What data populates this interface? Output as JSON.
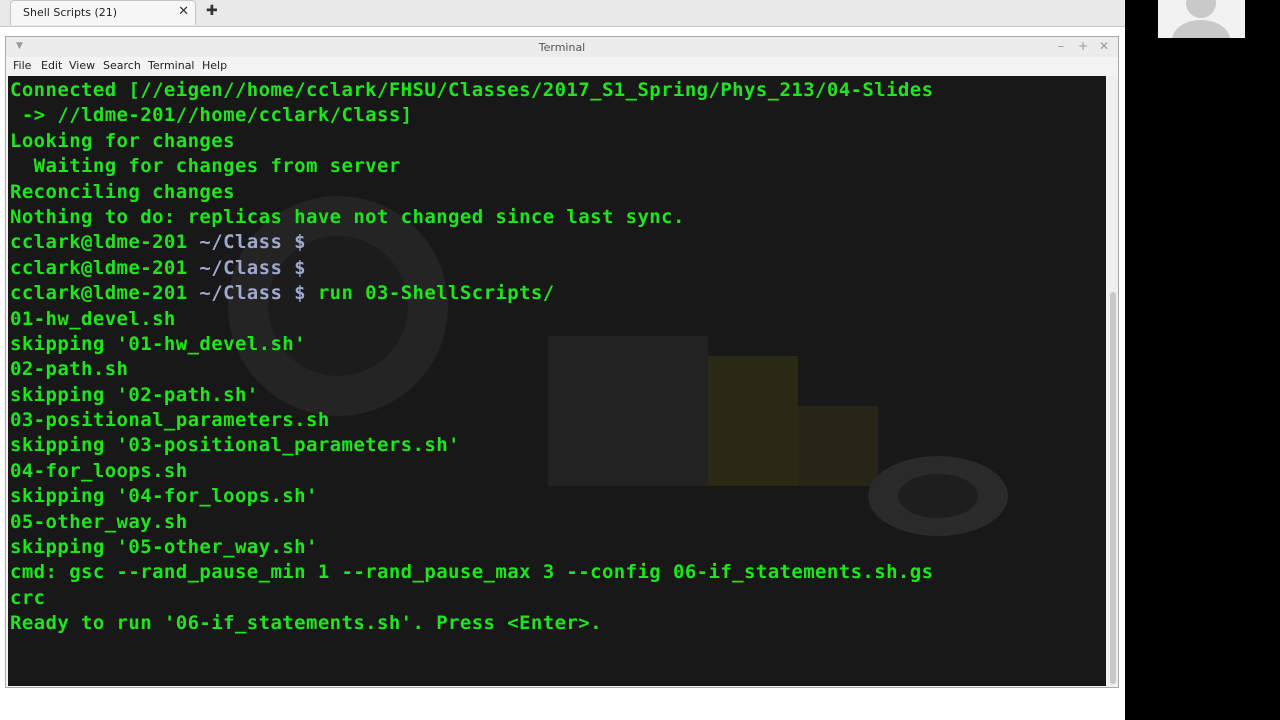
{
  "browser": {
    "tab_label": "Shell Scripts (21)",
    "close_glyph": "✕",
    "newtab_glyph": "✚"
  },
  "terminal": {
    "title": "Terminal",
    "menu": [
      "File",
      "Edit",
      "View",
      "Search",
      "Terminal",
      "Help"
    ],
    "window_buttons": [
      "–",
      "+",
      "✕"
    ],
    "colors": {
      "text": "#1ee51e",
      "path": "#9fa9cf",
      "background": "#181818"
    },
    "lines": [
      {
        "text": "Connected [//eigen//home/cclark/FHSU/Classes/2017_S1_Spring/Phys_213/04-Slides"
      },
      {
        "text": " -> //ldme-201//home/cclark/Class]"
      },
      {
        "text": "Looking for changes"
      },
      {
        "text": "  Waiting for changes from server"
      },
      {
        "text": "Reconciling changes"
      },
      {
        "text": "Nothing to do: replicas have not changed since last sync."
      },
      {
        "user": "cclark@ldme-201",
        "path": " ~/Class $",
        "cmd": ""
      },
      {
        "user": "cclark@ldme-201",
        "path": " ~/Class $",
        "cmd": ""
      },
      {
        "user": "cclark@ldme-201",
        "path": " ~/Class $",
        "cmd": " run 03-ShellScripts/"
      },
      {
        "text": "01-hw_devel.sh"
      },
      {
        "text": "skipping '01-hw_devel.sh'"
      },
      {
        "text": "02-path.sh"
      },
      {
        "text": "skipping '02-path.sh'"
      },
      {
        "text": "03-positional_parameters.sh"
      },
      {
        "text": "skipping '03-positional_parameters.sh'"
      },
      {
        "text": "04-for_loops.sh"
      },
      {
        "text": "skipping '04-for_loops.sh'"
      },
      {
        "text": "05-other_way.sh"
      },
      {
        "text": "skipping '05-other_way.sh'"
      },
      {
        "text": "cmd: gsc --rand_pause_min 1 --rand_pause_max 3 --config 06-if_statements.sh.gs"
      },
      {
        "text": "crc"
      },
      {
        "text": "Ready to run '06-if_statements.sh'. Press <Enter>."
      }
    ]
  }
}
